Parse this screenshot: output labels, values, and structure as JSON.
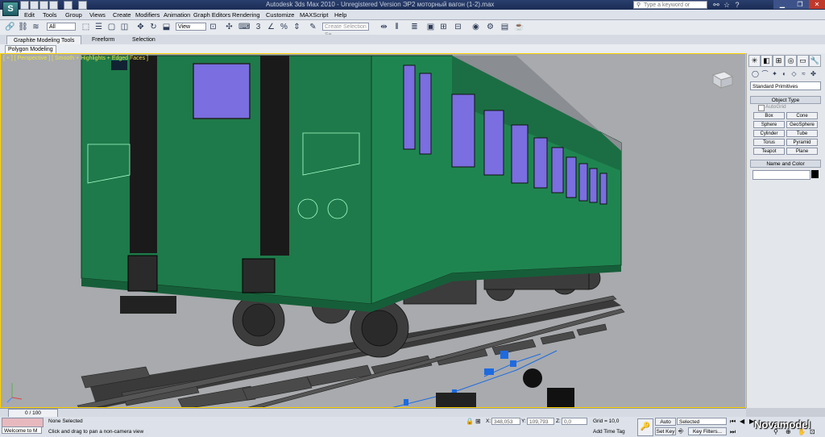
{
  "titlebar": {
    "title": "Autodesk 3ds Max 2010  -  Unregistered Version      ЭР2 моторный вагон (1-2).max",
    "search_placeholder": "Type a keyword or phrase",
    "icons": [
      "binoculars-icon",
      "star-icon",
      "question-icon"
    ],
    "window_buttons": [
      "minimize",
      "restore",
      "close"
    ]
  },
  "menu": [
    "Edit",
    "Tools",
    "Group",
    "Views",
    "Create",
    "Modifiers",
    "Animation",
    "Graph Editors",
    "Rendering",
    "Customize",
    "MAXScript",
    "Help"
  ],
  "toolbar": {
    "selection_filter": "All",
    "reference_coord": "View",
    "named_selection_placeholder": "Create Selection Se"
  },
  "ribbon": {
    "tabs": [
      "Graphite Modeling Tools",
      "Freeform",
      "Selection"
    ],
    "panel_button": "Polygon Modeling"
  },
  "viewport": {
    "label": "[ + ] [ Perspective ] [ Smooth + Highlights + Edged Faces ]",
    "label_color": "#e8e04a",
    "border_color": "#ffd200",
    "car_color": "#1e7a4a",
    "window_color": "#7a6ee0"
  },
  "command_panel": {
    "primitives_dropdown": "Standard Primitives",
    "object_type_title": "Object Type",
    "autogrid_label": "AutoGrid",
    "object_buttons": [
      "Box",
      "Cone",
      "Sphere",
      "GeoSphere",
      "Cylinder",
      "Tube",
      "Torus",
      "Pyramid",
      "Teapot",
      "Plane"
    ],
    "name_color_title": "Name and Color"
  },
  "timeline": {
    "slider_label": "0 / 100"
  },
  "status": {
    "selection_text": "None Selected",
    "prompt_text": "Click and drag to pan a non-camera view",
    "maxscript_text": "Welcome to M",
    "x_label": "X:",
    "x_value": "348,053",
    "y_label": "Y:",
    "y_value": "109,793",
    "z_label": "Z:",
    "z_value": "0,0",
    "grid_text": "Grid = 10,0",
    "add_time_tag": "Add Time Tag",
    "auto_key": "Auto Key",
    "set_key": "Set Key",
    "key_mode": "Selected",
    "key_filters": "Key Filters...",
    "watermark": "Novamodel"
  }
}
